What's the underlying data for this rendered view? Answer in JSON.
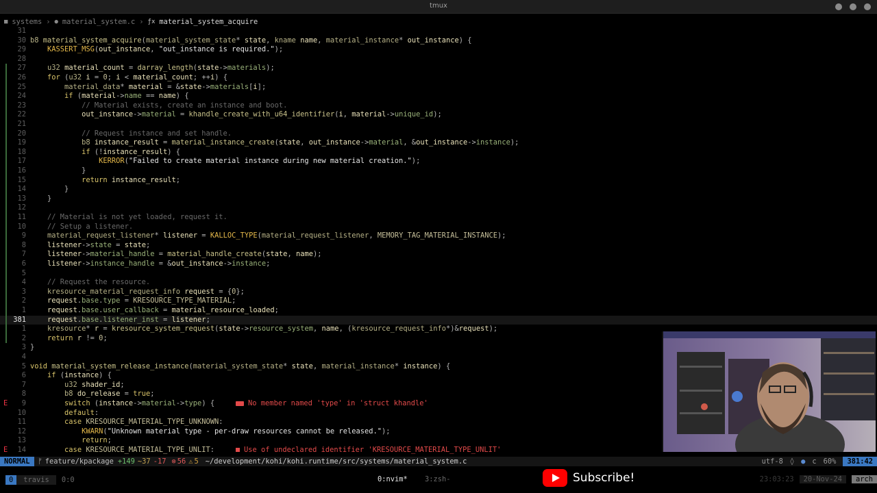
{
  "window": {
    "title": "tmux"
  },
  "breadcrumb": {
    "folder": "systems",
    "file": "material_system.c",
    "function": "material_system_acquire"
  },
  "editor": {
    "lines": [
      {
        "num": "31",
        "code": "",
        "git": false,
        "sign": ""
      },
      {
        "num": "30",
        "code": "b8 material_system_acquire(material_system_state* state, kname name, material_instance* out_instance) {",
        "git": false,
        "sign": ""
      },
      {
        "num": "29",
        "code": "    KASSERT_MSG(out_instance, \"out_instance is required.\");",
        "git": false,
        "sign": ""
      },
      {
        "num": "28",
        "code": "",
        "git": false,
        "sign": ""
      },
      {
        "num": "27",
        "code": "    u32 material_count = darray_length(state->materials);",
        "git": true,
        "sign": ""
      },
      {
        "num": "26",
        "code": "    for (u32 i = 0; i < material_count; ++i) {",
        "git": true,
        "sign": ""
      },
      {
        "num": "25",
        "code": "        material_data* material = &state->materials[i];",
        "git": true,
        "sign": ""
      },
      {
        "num": "24",
        "code": "        if (material->name == name) {",
        "git": true,
        "sign": ""
      },
      {
        "num": "23",
        "code": "            // Material exists, create an instance and boot.",
        "git": true,
        "sign": ""
      },
      {
        "num": "22",
        "code": "            out_instance->material = khandle_create_with_u64_identifier(i, material->unique_id);",
        "git": true,
        "sign": ""
      },
      {
        "num": "21",
        "code": "",
        "git": true,
        "sign": ""
      },
      {
        "num": "20",
        "code": "            // Request instance and set handle.",
        "git": true,
        "sign": ""
      },
      {
        "num": "19",
        "code": "            b8 instance_result = material_instance_create(state, out_instance->material, &out_instance->instance);",
        "git": true,
        "sign": ""
      },
      {
        "num": "18",
        "code": "            if (!instance_result) {",
        "git": true,
        "sign": ""
      },
      {
        "num": "17",
        "code": "                KERROR(\"Failed to create material instance during new material creation.\");",
        "git": true,
        "sign": ""
      },
      {
        "num": "16",
        "code": "            }",
        "git": true,
        "sign": ""
      },
      {
        "num": "15",
        "code": "            return instance_result;",
        "git": true,
        "sign": ""
      },
      {
        "num": "14",
        "code": "        }",
        "git": true,
        "sign": ""
      },
      {
        "num": "13",
        "code": "    }",
        "git": true,
        "sign": ""
      },
      {
        "num": "12",
        "code": "",
        "git": true,
        "sign": ""
      },
      {
        "num": "11",
        "code": "    // Material is not yet loaded, request it.",
        "git": true,
        "sign": ""
      },
      {
        "num": "10",
        "code": "    // Setup a listener.",
        "git": true,
        "sign": ""
      },
      {
        "num": "9",
        "code": "    material_request_listener* listener = KALLOC_TYPE(material_request_listener, MEMORY_TAG_MATERIAL_INSTANCE);",
        "git": true,
        "sign": ""
      },
      {
        "num": "8",
        "code": "    listener->state = state;",
        "git": true,
        "sign": ""
      },
      {
        "num": "7",
        "code": "    listener->material_handle = material_handle_create(state, name);",
        "git": true,
        "sign": ""
      },
      {
        "num": "6",
        "code": "    listener->instance_handle = &out_instance->instance;",
        "git": true,
        "sign": ""
      },
      {
        "num": "5",
        "code": "",
        "git": true,
        "sign": ""
      },
      {
        "num": "4",
        "code": "    // Request the resource.",
        "git": true,
        "sign": ""
      },
      {
        "num": "3",
        "code": "    kresource_material_request_info request = {0};",
        "git": true,
        "sign": ""
      },
      {
        "num": "2",
        "code": "    request.base.type = KRESOURCE_TYPE_MATERIAL;",
        "git": true,
        "sign": ""
      },
      {
        "num": "1",
        "code": "    request.base.user_callback = material_resource_loaded;",
        "git": true,
        "sign": ""
      },
      {
        "num": "381",
        "code": "    request.base.listener_inst = listener;",
        "git": true,
        "sign": "",
        "current": true
      },
      {
        "num": "1",
        "code": "    kresource* r = kresource_system_request(state->resource_system, name, (kresource_request_info*)&request);",
        "git": true,
        "sign": ""
      },
      {
        "num": "2",
        "code": "    return r != 0;",
        "git": true,
        "sign": ""
      },
      {
        "num": "3",
        "code": "}",
        "git": false,
        "sign": ""
      },
      {
        "num": "4",
        "code": "",
        "git": false,
        "sign": ""
      },
      {
        "num": "5",
        "code": "void material_system_release_instance(material_system_state* state, material_instance* instance) {",
        "git": false,
        "sign": ""
      },
      {
        "num": "6",
        "code": "    if (instance) {",
        "git": false,
        "sign": ""
      },
      {
        "num": "7",
        "code": "        u32 shader_id;",
        "git": false,
        "sign": ""
      },
      {
        "num": "8",
        "code": "        b8 do_release = true;",
        "git": false,
        "sign": ""
      },
      {
        "num": "9",
        "code": "        switch (instance->material->type) {",
        "git": false,
        "sign": "E",
        "diag": "No member named 'type' in 'struct khandle'",
        "diag_style": "box"
      },
      {
        "num": "10",
        "code": "        default:",
        "git": false,
        "sign": ""
      },
      {
        "num": "11",
        "code": "        case KRESOURCE_MATERIAL_TYPE_UNKNOWN:",
        "git": false,
        "sign": ""
      },
      {
        "num": "12",
        "code": "            KWARN(\"Unknown material type - per-draw resources cannot be released.\");",
        "git": false,
        "sign": ""
      },
      {
        "num": "13",
        "code": "            return;",
        "git": false,
        "sign": ""
      },
      {
        "num": "14",
        "code": "        case KRESOURCE_MATERIAL_TYPE_UNLIT:",
        "git": false,
        "sign": "E",
        "diag": "Use of undeclared identifier 'KRESOURCE_MATERIAL_TYPE_UNLIT'",
        "diag_style": "dot"
      }
    ]
  },
  "statusline": {
    "mode": "NORMAL",
    "branch_icon": "git-branch-icon",
    "branch": "feature/kpackage",
    "added": "+149",
    "modified": "~37",
    "removed": "-17",
    "errors": "56",
    "warnings": "5",
    "path": "~/development/kohi/kohi.runtime/src/systems/material_system.c",
    "encoding": "utf-8",
    "filetype": "c",
    "percent": "60%",
    "position": "381:42"
  },
  "tmux": {
    "session": "0",
    "host": "travis",
    "pane": "0:0",
    "window_active": "0:nvim*",
    "window_other": "3:zsh-",
    "time": "23:03:23",
    "date": "20-Nov-24",
    "os": "arch"
  },
  "overlay": {
    "subscribe": "Subscribe!"
  },
  "colors": {
    "mode_bg": "#3a78c2",
    "error": "#e34a4a",
    "subscribe_red": "#ff0000"
  }
}
